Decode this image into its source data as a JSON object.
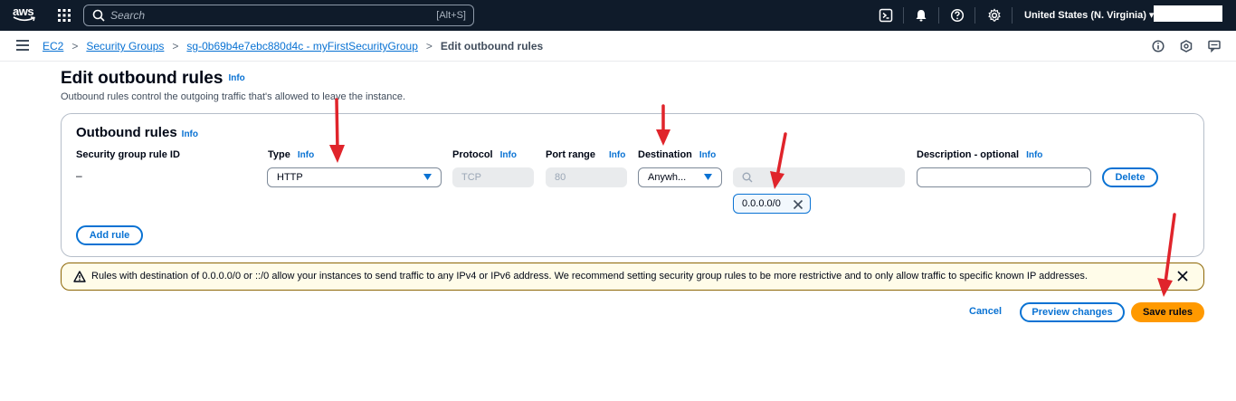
{
  "topnav": {
    "logo_text": "aws",
    "search_placeholder": "Search",
    "search_shortcut": "[Alt+S]",
    "region": "United States (N. Virginia) ▾"
  },
  "breadcrumb": {
    "items": [
      "EC2",
      "Security Groups",
      "sg-0b69b4e7ebc880d4c - myFirstSecurityGroup"
    ],
    "current": "Edit outbound rules"
  },
  "page": {
    "title": "Edit outbound rules",
    "info": "Info",
    "description": "Outbound rules control the outgoing traffic that's allowed to leave the instance."
  },
  "outbound": {
    "title": "Outbound rules",
    "info": "Info",
    "columns": {
      "rule_id": "Security group rule ID",
      "type": "Type",
      "protocol": "Protocol",
      "port_range": "Port range",
      "destination": "Destination",
      "description": "Description - optional"
    },
    "rule": {
      "rule_id": "–",
      "type": "HTTP",
      "protocol": "TCP",
      "port_range": "80",
      "destination": "Anywh...",
      "cidr_token": "0.0.0.0/0",
      "description": ""
    },
    "delete_label": "Delete",
    "add_rule_label": "Add rule"
  },
  "warning": {
    "text": "Rules with destination of 0.0.0.0/0 or ::/0 allow your instances to send traffic to any IPv4 or IPv6 address. We recommend setting security group rules to be more restrictive and to only allow traffic to specific known IP addresses."
  },
  "actions": {
    "cancel": "Cancel",
    "preview": "Preview changes",
    "save": "Save rules"
  },
  "colors": {
    "nav_bg": "#0f1b2a",
    "link": "#0972d3",
    "primary": "#ff9900",
    "warning_bg": "#fffce9",
    "annotation": "#e0242b"
  }
}
